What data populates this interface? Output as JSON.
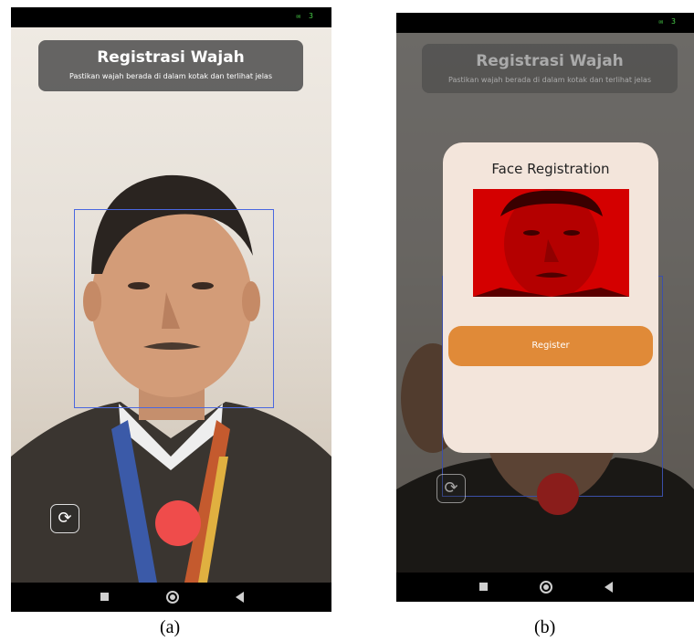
{
  "screen_a": {
    "status_icons": "✉ 3",
    "header": {
      "title": "Registrasi Wajah",
      "subtitle": "Pastikan wajah berada di dalam kotak dan terlihat jelas"
    },
    "switch_camera_icon": "⟳",
    "caption": "(a)"
  },
  "screen_b": {
    "status_icons": "✉ 3",
    "header": {
      "title": "Registrasi Wajah",
      "subtitle": "Pastikan wajah berada di dalam kotak dan terlihat jelas"
    },
    "dialog": {
      "title": "Face Registration",
      "register_label": "Register"
    },
    "switch_camera_icon": "⟳",
    "caption": "(b)"
  },
  "colors": {
    "accent_orange": "#e08a38",
    "shutter_red": "#ef4c4b",
    "frame_blue": "#4a67e0"
  }
}
